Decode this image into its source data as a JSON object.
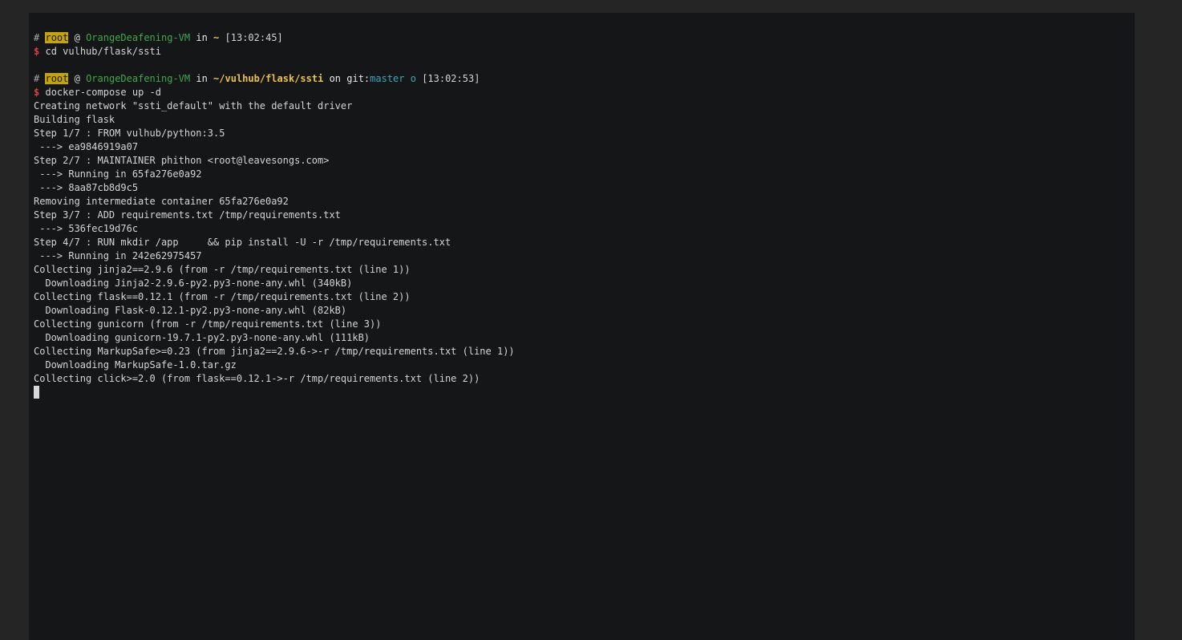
{
  "prompt1": {
    "hash": "#",
    "user": "root",
    "at": "@",
    "host": "OrangeDeafening-VM",
    "in": "in",
    "path": "~",
    "time": "[13:02:45]"
  },
  "command1": {
    "symbol": "$",
    "text": "cd vulhub/flask/ssti"
  },
  "prompt2": {
    "hash": "#",
    "user": "root",
    "at": "@",
    "host": "OrangeDeafening-VM",
    "in": "in",
    "path": "~/vulhub/flask/ssti",
    "on": "on",
    "git_label": "git:",
    "branch": "master o",
    "time": "[13:02:53]"
  },
  "command2": {
    "symbol": "$",
    "text": "docker-compose up -d"
  },
  "output": [
    "Creating network \"ssti_default\" with the default driver",
    "Building flask",
    "Step 1/7 : FROM vulhub/python:3.5",
    " ---> ea9846919a07",
    "Step 2/7 : MAINTAINER phithon <root@leavesongs.com>",
    " ---> Running in 65fa276e0a92",
    " ---> 8aa87cb8d9c5",
    "Removing intermediate container 65fa276e0a92",
    "Step 3/7 : ADD requirements.txt /tmp/requirements.txt",
    " ---> 536fec19d76c",
    "Step 4/7 : RUN mkdir /app     && pip install -U -r /tmp/requirements.txt",
    " ---> Running in 242e62975457",
    "Collecting jinja2==2.9.6 (from -r /tmp/requirements.txt (line 1))",
    "  Downloading Jinja2-2.9.6-py2.py3-none-any.whl (340kB)",
    "Collecting flask==0.12.1 (from -r /tmp/requirements.txt (line 2))",
    "  Downloading Flask-0.12.1-py2.py3-none-any.whl (82kB)",
    "Collecting gunicorn (from -r /tmp/requirements.txt (line 3))",
    "  Downloading gunicorn-19.7.1-py2.py3-none-any.whl (111kB)",
    "Collecting MarkupSafe>=0.23 (from jinja2==2.9.6->-r /tmp/requirements.txt (line 1))",
    "  Downloading MarkupSafe-1.0.tar.gz",
    "Collecting click>=2.0 (from flask==0.12.1->-r /tmp/requirements.txt (line 2))"
  ],
  "colors": {
    "background": "#252526",
    "terminal_bg": "#151618",
    "user_bg": "#c7a500",
    "host": "#3fa94a",
    "path": "#e8c34a",
    "branch": "#3aa8b8",
    "dollar": "#e0403a"
  }
}
